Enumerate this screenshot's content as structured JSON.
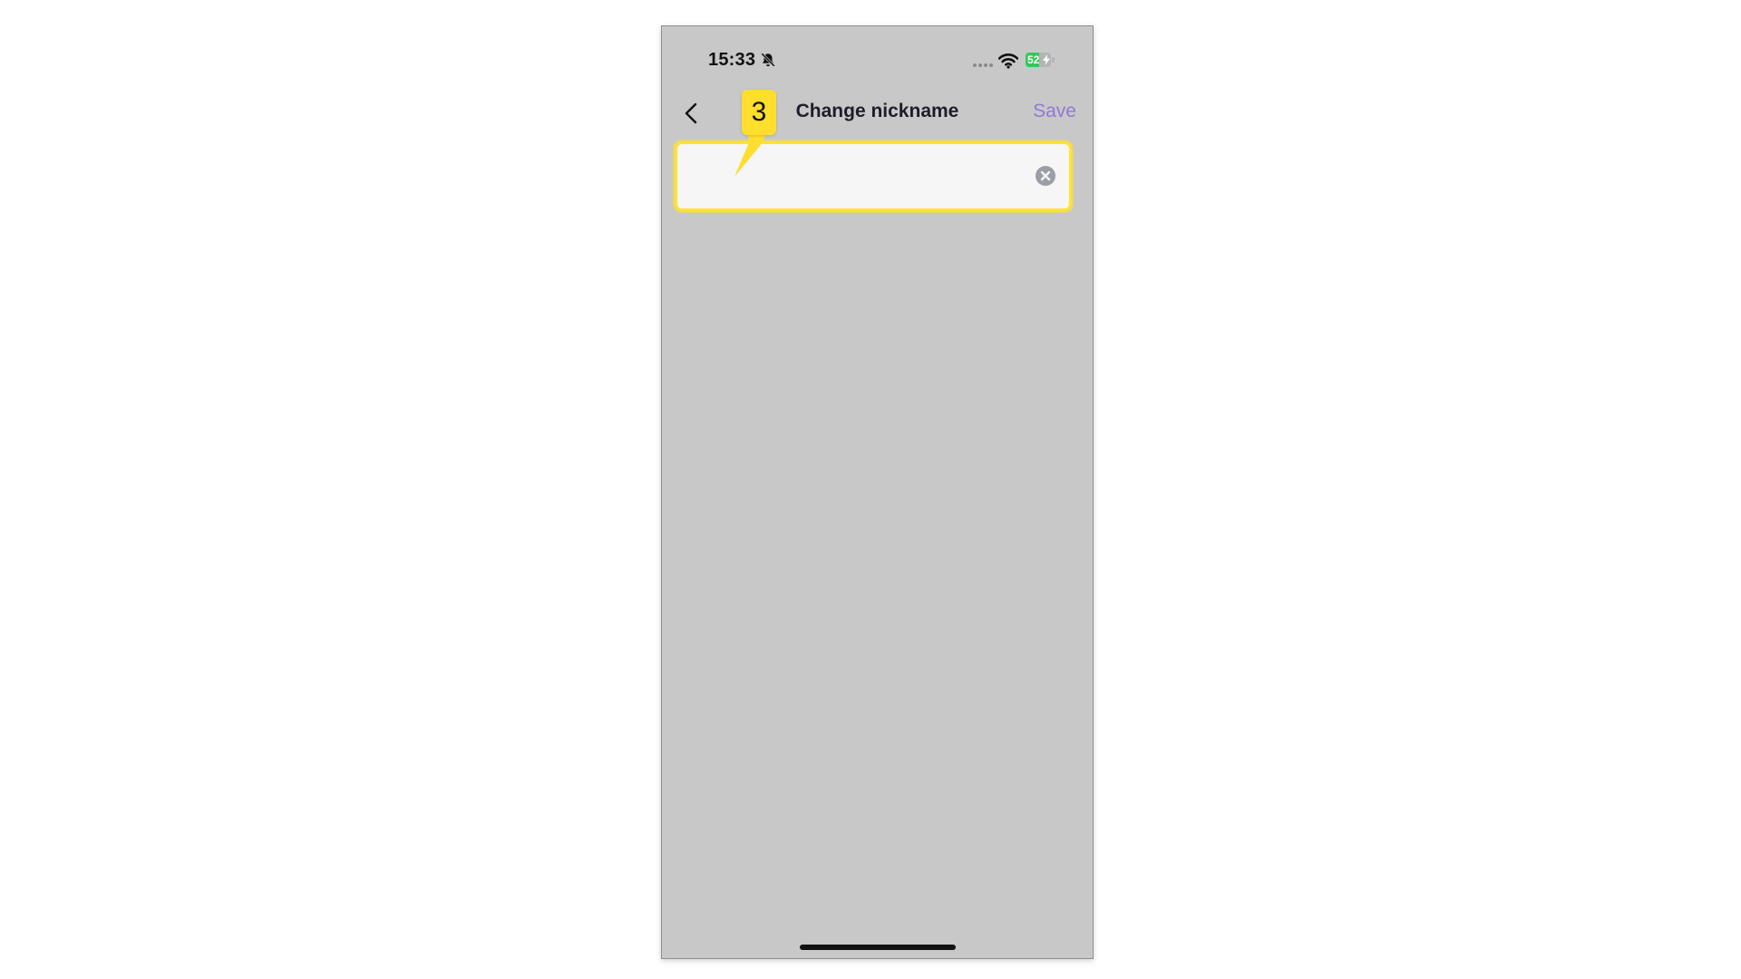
{
  "status_bar": {
    "time": "15:33",
    "battery_percent": "52",
    "battery_level": 0.52,
    "icons": [
      "bell-slash-icon",
      "cellular-signal-icon",
      "wifi-icon",
      "battery-charging-icon"
    ]
  },
  "nav": {
    "title": "Change nickname",
    "save_label": "Save",
    "back_icon": "chevron-left-icon"
  },
  "nickname_field": {
    "value": "",
    "placeholder": "",
    "clear_icon": "clear-circle-icon"
  },
  "step_callout": {
    "number": "3"
  },
  "colors": {
    "screen_background": "#c8c8c8",
    "accent": "#8f7ad6",
    "highlight": "#ffe332",
    "battery_green": "#34c759"
  }
}
